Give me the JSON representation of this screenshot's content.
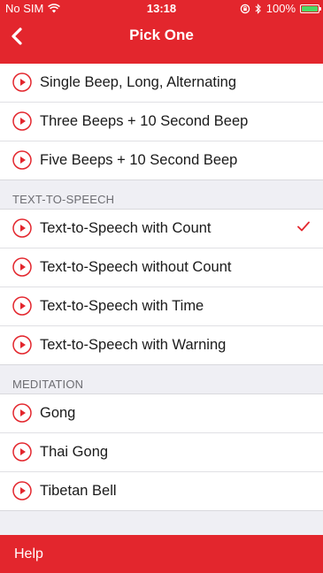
{
  "status_bar": {
    "carrier": "No SIM",
    "time": "13:18",
    "battery": "100%",
    "battery_level": 1.0
  },
  "nav": {
    "title": "Pick One"
  },
  "sections": [
    {
      "header": "",
      "items": [
        {
          "label": "Single Beep, Long, Alternating",
          "selected": false
        },
        {
          "label": "Three Beeps + 10 Second Beep",
          "selected": false
        },
        {
          "label": "Five Beeps + 10 Second Beep",
          "selected": false
        }
      ]
    },
    {
      "header": "TEXT-TO-SPEECH",
      "items": [
        {
          "label": "Text-to-Speech with Count",
          "selected": true
        },
        {
          "label": "Text-to-Speech without Count",
          "selected": false
        },
        {
          "label": "Text-to-Speech with Time",
          "selected": false
        },
        {
          "label": "Text-to-Speech with Warning",
          "selected": false
        }
      ]
    },
    {
      "header": "MEDITATION",
      "items": [
        {
          "label": "Gong",
          "selected": false
        },
        {
          "label": "Thai Gong",
          "selected": false
        },
        {
          "label": "Tibetan Bell",
          "selected": false
        }
      ]
    }
  ],
  "footer": {
    "help_label": "Help"
  },
  "colors": {
    "accent": "#e3262d",
    "background": "#efeff4",
    "battery": "#4cd964"
  },
  "icons": {
    "play": "play-circle-icon",
    "check": "checkmark-icon",
    "back": "chevron-left-icon"
  }
}
